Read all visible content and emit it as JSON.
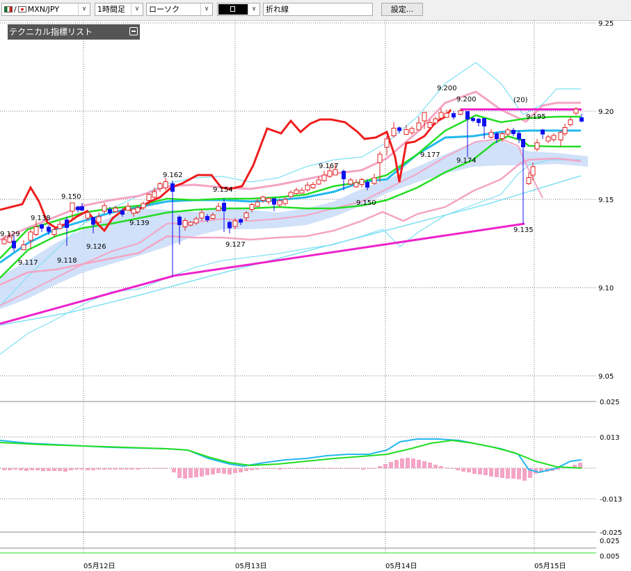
{
  "toolbar": {
    "symbol": "MXN/JPY",
    "timeframe": "1時間足",
    "chart_style": "ローソク",
    "line_label": "折れ線",
    "settings_label": "設定..."
  },
  "indicator_panel": {
    "title": "テクニカル指標リスト"
  },
  "colors": {
    "up_candle": "#e02020",
    "down_candle": "#1010ee",
    "ma_fast": "#22dd22",
    "ma_mid": "#22b8ee",
    "bollinger": "#f4a4c4",
    "envelope": "#7ee0f4",
    "cloud": "#c8dcf8",
    "price_line": "#ee1c1c",
    "trendline": "#ee22cc"
  },
  "chart_data": {
    "type": "candlestick",
    "symbol": "MXN/JPY",
    "ylim": [
      9.04,
      9.25
    ],
    "y_ticks": [
      "9.25",
      "9.20",
      "9.15",
      "9.10",
      "9.05"
    ],
    "x_ticks": [
      "05月12日",
      "05月13日",
      "05月14日",
      "05月15日"
    ],
    "price_labels": [
      "9.129",
      "9.138",
      "9.117",
      "9.150",
      "9.118",
      "9.126",
      "9.139",
      "9.162",
      "9.154",
      "9.127",
      "9.167",
      "9.150",
      "9.200",
      "9.200",
      "9.177",
      "9.174",
      "9.195",
      "9.135"
    ],
    "period_label": "(20)",
    "resistance_level": 9.201,
    "oscillator_ticks": [
      "0.025",
      "0.013",
      "-0.013",
      "-0.025"
    ],
    "lower_ticks": [
      "0.025",
      "0.005"
    ]
  }
}
